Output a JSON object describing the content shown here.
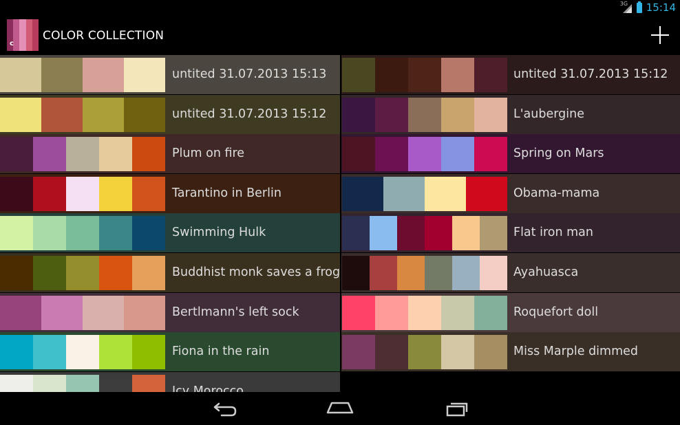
{
  "status": {
    "network": "3G",
    "time": "15:14"
  },
  "app": {
    "title": "COLOR COLLECTION",
    "icon_letter": "c",
    "icon_colors": [
      "#8b2d5a",
      "#c25b8d",
      "#e48fb6",
      "#d15b74",
      "#b53c5a"
    ]
  },
  "icons": {
    "add": "plus-icon",
    "back": "back-icon",
    "home": "home-icon",
    "recents": "recents-icon"
  },
  "left_list": [
    {
      "label": "untited 31.07.2013 15:13",
      "bg": "#4b463f",
      "colors": [
        "#d6c899",
        "#8b7f52",
        "#d8a197",
        "#f4e6bb"
      ]
    },
    {
      "label": "untited 31.07.2013 15:12",
      "bg": "#3f3a22",
      "colors": [
        "#efe27a",
        "#b0553a",
        "#aaa03a",
        "#6f6110"
      ]
    },
    {
      "label": "Plum on fire",
      "bg": "#3f2826",
      "colors": [
        "#4a1d3c",
        "#9c4d9c",
        "#b8b09b",
        "#e6cc9c",
        "#cc4a10"
      ]
    },
    {
      "label": "Tarantino in Berlin",
      "bg": "#3c2113",
      "colors": [
        "#3c0a18",
        "#b0101e",
        "#f5dff2",
        "#f3d23c",
        "#d1531c"
      ]
    },
    {
      "label": "Swimming Hulk",
      "bg": "#23403a",
      "colors": [
        "#d3f2a3",
        "#a8dba8",
        "#79bd9a",
        "#3b8686",
        "#0b486b"
      ]
    },
    {
      "label": "Buddhist monk saves a frog",
      "bg": "#3a301e",
      "colors": [
        "#4a2c00",
        "#4e5e10",
        "#948d2c",
        "#d95410",
        "#e5a05c"
      ]
    },
    {
      "label": "Bertlmann's left sock",
      "bg": "#412c39",
      "colors": [
        "#98447c",
        "#c97bb2",
        "#d9b0ac",
        "#d9988c"
      ]
    },
    {
      "label": "Fiona in the rain",
      "bg": "#2a4a30",
      "colors": [
        "#00a8c6",
        "#40c0cb",
        "#f9f2e7",
        "#aee239",
        "#8fbe00"
      ]
    },
    {
      "label": "Icy Morocco",
      "bg": "#3a3a3a",
      "colors": [
        "#eeeeea",
        "#d8e4cc",
        "#96c6b2",
        "#3c3c3c",
        "#d4623a"
      ]
    }
  ],
  "right_list": [
    {
      "label": "untited 31.07.2013 15:12",
      "bg": "#2b1b1b",
      "colors": [
        "#4a4820",
        "#3c1a10",
        "#4e2418",
        "#b7786a",
        "#4e1e2a"
      ]
    },
    {
      "label": "L'aubergine",
      "bg": "#33272a",
      "colors": [
        "#3a1640",
        "#5c1c44",
        "#8b6e58",
        "#c6a46c",
        "#e2b4a0"
      ]
    },
    {
      "label": "Spring on Mars",
      "bg": "#33162f",
      "colors": [
        "#4e1424",
        "#6c1252",
        "#a85bc8",
        "#8594e2",
        "#cc0b52"
      ]
    },
    {
      "label": "Obama-mama",
      "bg": "#3a2c2a",
      "colors": [
        "#13294b",
        "#8fadb0",
        "#fde7a0",
        "#d0091d"
      ]
    },
    {
      "label": "Flat iron man",
      "bg": "#33232c",
      "colors": [
        "#2b2f52",
        "#8bbcef",
        "#6e0c30",
        "#a2002e",
        "#f8c88c",
        "#b09a72"
      ]
    },
    {
      "label": "Ayahuasca",
      "bg": "#3a2e2c",
      "colors": [
        "#1e0c0c",
        "#a84040",
        "#d88840",
        "#737b66",
        "#98b0c0",
        "#f4cec4"
      ]
    },
    {
      "label": "Roquefort doll",
      "bg": "#4a3a3c",
      "colors": [
        "#ff4266",
        "#ff9c9a",
        "#fdd0b0",
        "#c8c8aa",
        "#82b09a"
      ]
    },
    {
      "label": "Miss Marple dimmed",
      "bg": "#3a2f27",
      "colors": [
        "#7a3a62",
        "#4e2e32",
        "#8a8a3c",
        "#d3c7a6",
        "#a68e62"
      ]
    }
  ]
}
